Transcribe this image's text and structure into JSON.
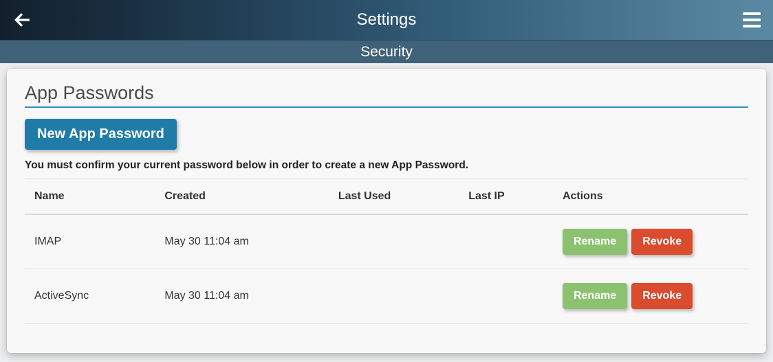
{
  "header": {
    "title": "Settings"
  },
  "subheader": {
    "title": "Security"
  },
  "card": {
    "title": "App Passwords",
    "new_button": "New App Password",
    "instruction": "You must confirm your current password below in order to create a new App Password."
  },
  "table": {
    "columns": {
      "name": "Name",
      "created": "Created",
      "last_used": "Last Used",
      "last_ip": "Last IP",
      "actions": "Actions"
    },
    "action_labels": {
      "rename": "Rename",
      "revoke": "Revoke"
    },
    "rows": [
      {
        "name": "IMAP",
        "created": "May 30 11:04 am",
        "last_used": "",
        "last_ip": ""
      },
      {
        "name": "ActiveSync",
        "created": "May 30 11:04 am",
        "last_used": "",
        "last_ip": ""
      }
    ]
  }
}
